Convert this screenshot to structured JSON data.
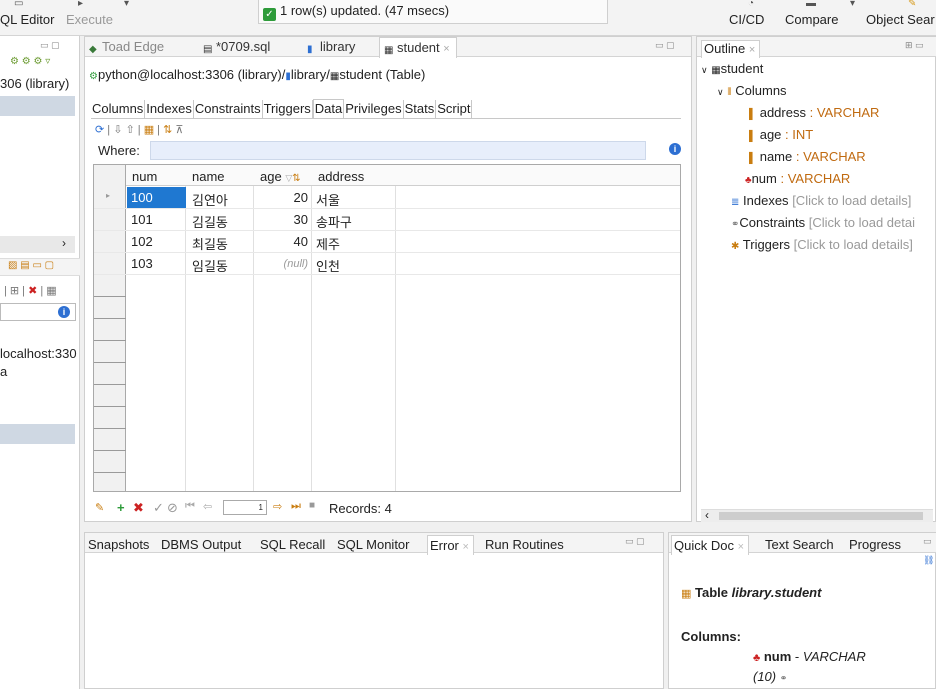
{
  "toolbar": {
    "sql_editor": "QL Editor",
    "execute": "Execute",
    "cicd": "CI/CD",
    "compare": "Compare",
    "object_search": "Object Sear"
  },
  "notice": {
    "text": "1 row(s) updated. (47 msecs)"
  },
  "left_strip": {
    "line1": "306 (library)",
    "line2": "localhost:330",
    "line3": "a"
  },
  "editor": {
    "tabs": [
      {
        "label": "Toad Edge"
      },
      {
        "label": "*0709.sql"
      },
      {
        "label": "library"
      },
      {
        "label": "student"
      }
    ],
    "path": {
      "conn": "python@localhost:3306 (library)/",
      "schema": "library/",
      "table": "student (Table)"
    },
    "subtabs": [
      "Columns",
      "Indexes",
      "Constraints",
      "Triggers",
      "Data",
      "Privileges",
      "Stats",
      "Script"
    ],
    "where_label": "Where:",
    "grid": {
      "columns": [
        "num",
        "name",
        "age",
        "address"
      ],
      "rows": [
        {
          "num": "100",
          "name": "김연아",
          "age": "20",
          "address": "서울"
        },
        {
          "num": "101",
          "name": "김길동",
          "age": "30",
          "address": "송파구"
        },
        {
          "num": "102",
          "name": "최길동",
          "age": "40",
          "address": "제주"
        },
        {
          "num": "103",
          "name": "임길동",
          "age": "(null)",
          "address": "인천"
        }
      ]
    },
    "status": {
      "page": "1",
      "records": "Records: 4"
    }
  },
  "outline": {
    "title": "Outline",
    "table": "student",
    "columns_label": "Columns",
    "columns": [
      {
        "name": "address",
        "type": ": VARCHAR"
      },
      {
        "name": "age",
        "type": ": INT"
      },
      {
        "name": "name",
        "type": ": VARCHAR"
      },
      {
        "name": "num",
        "type": ": VARCHAR"
      }
    ],
    "indexes": "Indexes",
    "indexes_hint": "[Click to load details]",
    "constraints": "Constraints",
    "constraints_hint": "[Click to load detai",
    "triggers": "Triggers",
    "triggers_hint": "[Click to load details]"
  },
  "bottom_left": {
    "tabs": [
      "Snapshots",
      "DBMS Output",
      "SQL Recall",
      "SQL Monitor",
      "Error",
      "Run Routines"
    ]
  },
  "bottom_right": {
    "tabs": [
      "Quick Doc",
      "Text Search",
      "Progress"
    ],
    "table_prefix": "Table ",
    "table_name": "library.student",
    "columns_label": "Columns:",
    "col_name": "num",
    "col_sep": " - ",
    "col_type": "VARCHAR",
    "col_len": "(10)"
  },
  "colors": {
    "accent": "#1f78d1",
    "type": "#c06a10",
    "selection": "#cfd8e3"
  }
}
